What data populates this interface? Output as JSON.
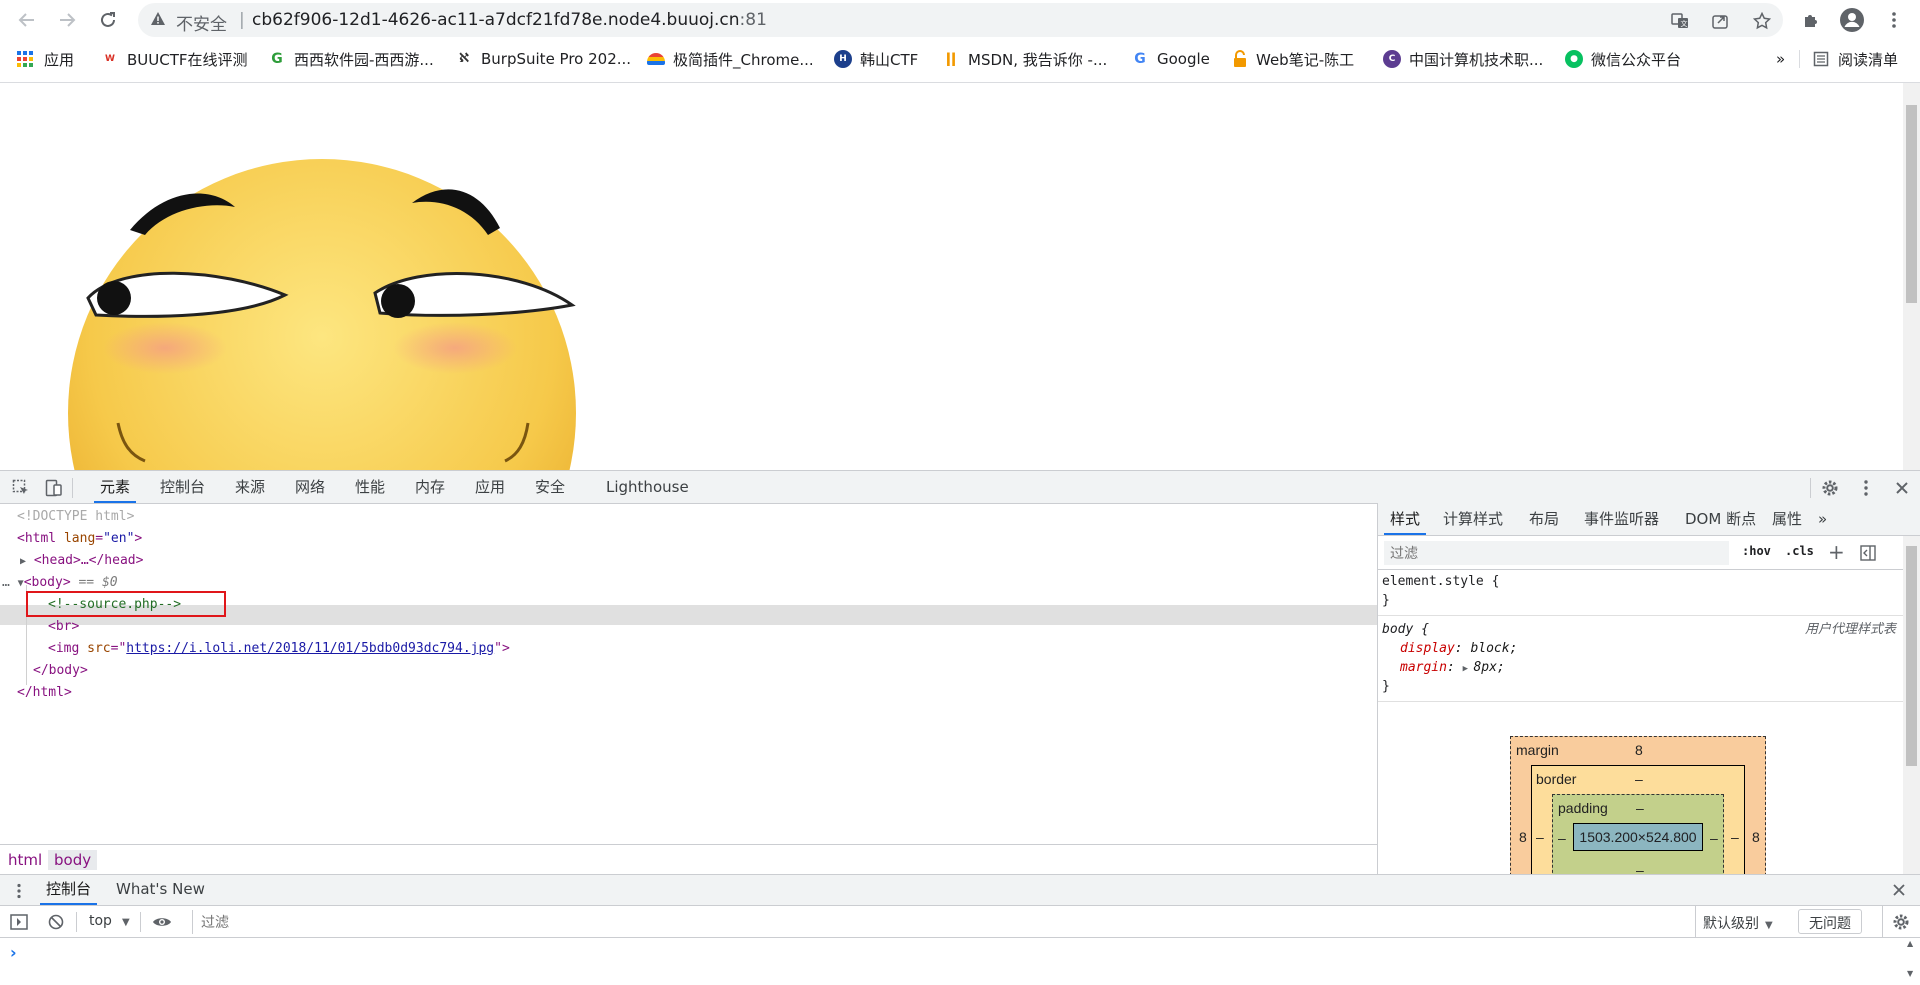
{
  "browser": {
    "insecure_label": "不安全",
    "separator": "|",
    "url_host": "cb62f906-12d1-4626-ac11-a7dcf21fd78e.node4.buuoj.cn",
    "url_port": ":81",
    "bookmarks": [
      {
        "label": "应用",
        "icon": "apps-grid-icon"
      },
      {
        "label": "BUUCTF在线评测",
        "icon": "buuctf-icon"
      },
      {
        "label": "西西软件园-西西游...",
        "icon": "xixi-icon"
      },
      {
        "label": "BurpSuite Pro 202...",
        "icon": "burpsuite-icon"
      },
      {
        "label": "极简插件_Chrome...",
        "icon": "rainbow-icon"
      },
      {
        "label": "韩山CTF",
        "icon": "hanshan-icon"
      },
      {
        "label": "MSDN, 我告诉你 -...",
        "icon": "msdn-icon"
      },
      {
        "label": "Google",
        "icon": "google-icon"
      },
      {
        "label": "Web笔记-陈工",
        "icon": "lock-icon"
      },
      {
        "label": "中国计算机技术职...",
        "icon": "computer-org-icon"
      },
      {
        "label": "微信公众平台",
        "icon": "wechat-icon"
      }
    ],
    "more_bookmarks": "»",
    "reading_list": "阅读清单"
  },
  "devtools": {
    "tabs": [
      "元素",
      "控制台",
      "来源",
      "网络",
      "性能",
      "内存",
      "应用",
      "安全",
      "Lighthouse"
    ],
    "dom": {
      "doctype": "<!DOCTYPE html>",
      "html_open_tag": "<html",
      "html_attr": "lang",
      "html_attr_val": "\"en\"",
      "head": "<head>…</head>",
      "body_open": "<body>",
      "body_marker": " == $0",
      "comment": "<!--source.php-->",
      "br": "<br>",
      "img_tag": "<img",
      "img_attr": "src",
      "img_src": "https://i.loli.net/2018/11/01/5bdb0d93dc794.jpg",
      "body_close": "</body>",
      "html_close": "</html>",
      "gutter": "…"
    },
    "breadcrumb": [
      "html",
      "body"
    ],
    "styles_tabs": [
      "样式",
      "计算样式",
      "布局",
      "事件监听器",
      "DOM 断点",
      "属性"
    ],
    "styles_more": "»",
    "filter_placeholder": "过滤",
    "hov": ":hov",
    "cls": ".cls",
    "element_style_selector": "element.style {",
    "close_brace": "}",
    "body_selector": "body {",
    "user_agent_label": "用户代理样式表",
    "rules": [
      {
        "prop": "display",
        "value": "block;"
      },
      {
        "prop": "margin",
        "value": "8px;"
      }
    ],
    "box_model": {
      "margin_label": "margin",
      "margin_value": "8",
      "border_label": "border",
      "border_value": "–",
      "padding_label": "padding",
      "padding_value": "–",
      "content_size": "1503.200×524.800",
      "left_margin": "8",
      "right_margin": "8",
      "dash": "–"
    },
    "drawer": {
      "tabs": [
        "控制台",
        "What's New"
      ],
      "context": "top",
      "filter_placeholder": "过滤",
      "level": "默认级别",
      "issues": "无问题",
      "prompt": "›"
    }
  }
}
